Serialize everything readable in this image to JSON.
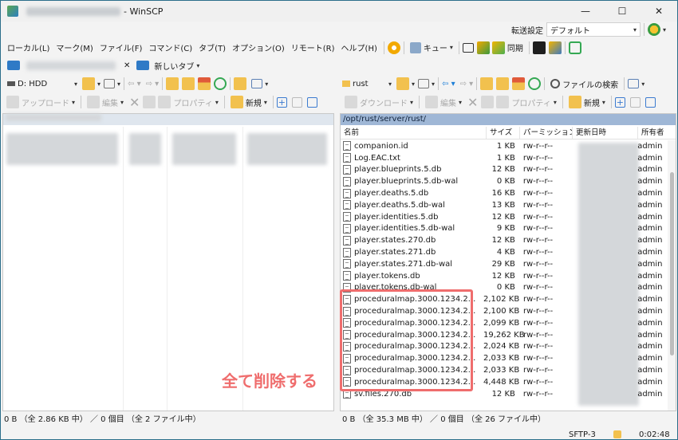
{
  "window": {
    "title_suffix": "- WinSCP",
    "min": "—",
    "max": "☐",
    "close": "✕"
  },
  "prefs": {
    "label": "転送設定",
    "preset": "デフォルト"
  },
  "menu": [
    "ローカル(L)",
    "マーク(M)",
    "ファイル(F)",
    "コマンド(C)",
    "タブ(T)",
    "オプション(O)",
    "リモート(R)",
    "ヘルプ(H)"
  ],
  "toolbar": {
    "queue": "キュー",
    "sync": "同期"
  },
  "tabs": {
    "close": "✕",
    "new_tab": "新しいタブ"
  },
  "left": {
    "drive": "D: HDD",
    "upload": "アップロード",
    "edit": "編集",
    "properties": "プロパティ",
    "new": "新規",
    "status": "0 B （全 2.86 KB 中） ／ 0 個目 （全 2 ファイル中）"
  },
  "right": {
    "dir": "rust",
    "find": "ファイルの検索",
    "download": "ダウンロード",
    "edit": "編集",
    "properties": "プロパティ",
    "new": "新規",
    "path": "/opt/rust/server/rust/",
    "cols": {
      "name": "名前",
      "size": "サイズ",
      "perm": "パーミッション",
      "date": "更新日時",
      "owner": "所有者"
    },
    "status": "0 B （全 35.3 MB 中） ／ 0 個目 （全 26 ファイル中）",
    "files": [
      {
        "name": "companion.id",
        "size": "1 KB",
        "perm": "rw-r--r--",
        "owner": "admin"
      },
      {
        "name": "Log.EAC.txt",
        "size": "1 KB",
        "perm": "rw-r--r--",
        "owner": "admin"
      },
      {
        "name": "player.blueprints.5.db",
        "size": "12 KB",
        "perm": "rw-r--r--",
        "owner": "admin"
      },
      {
        "name": "player.blueprints.5.db-wal",
        "size": "0 KB",
        "perm": "rw-r--r--",
        "owner": "admin"
      },
      {
        "name": "player.deaths.5.db",
        "size": "16 KB",
        "perm": "rw-r--r--",
        "owner": "admin"
      },
      {
        "name": "player.deaths.5.db-wal",
        "size": "13 KB",
        "perm": "rw-r--r--",
        "owner": "admin"
      },
      {
        "name": "player.identities.5.db",
        "size": "12 KB",
        "perm": "rw-r--r--",
        "owner": "admin"
      },
      {
        "name": "player.identities.5.db-wal",
        "size": "9 KB",
        "perm": "rw-r--r--",
        "owner": "admin"
      },
      {
        "name": "player.states.270.db",
        "size": "12 KB",
        "perm": "rw-r--r--",
        "owner": "admin"
      },
      {
        "name": "player.states.271.db",
        "size": "4 KB",
        "perm": "rw-r--r--",
        "owner": "admin"
      },
      {
        "name": "player.states.271.db-wal",
        "size": "29 KB",
        "perm": "rw-r--r--",
        "owner": "admin"
      },
      {
        "name": "player.tokens.db",
        "size": "12 KB",
        "perm": "rw-r--r--",
        "owner": "admin"
      },
      {
        "name": "player.tokens.db-wal",
        "size": "0 KB",
        "perm": "rw-r--r--",
        "owner": "admin"
      },
      {
        "name": "proceduralmap.3000.1234.2...",
        "size": "2,102 KB",
        "perm": "rw-r--r--",
        "owner": "admin"
      },
      {
        "name": "proceduralmap.3000.1234.2...",
        "size": "2,100 KB",
        "perm": "rw-r--r--",
        "owner": "admin"
      },
      {
        "name": "proceduralmap.3000.1234.2...",
        "size": "2,099 KB",
        "perm": "rw-r--r--",
        "owner": "admin"
      },
      {
        "name": "proceduralmap.3000.1234.2...",
        "size": "19,262 KB",
        "perm": "rw-r--r--",
        "owner": "admin"
      },
      {
        "name": "proceduralmap.3000.1234.2...",
        "size": "2,024 KB",
        "perm": "rw-r--r--",
        "owner": "admin"
      },
      {
        "name": "proceduralmap.3000.1234.2...",
        "size": "2,033 KB",
        "perm": "rw-r--r--",
        "owner": "admin"
      },
      {
        "name": "proceduralmap.3000.1234.2...",
        "size": "2,033 KB",
        "perm": "rw-r--r--",
        "owner": "admin"
      },
      {
        "name": "proceduralmap.3000.1234.2...",
        "size": "4,448 KB",
        "perm": "rw-r--r--",
        "owner": "admin"
      },
      {
        "name": "sv.files.270.db",
        "size": "12 KB",
        "perm": "rw-r--r--",
        "owner": "admin"
      }
    ]
  },
  "annotation": "全て削除する",
  "footer": {
    "protocol": "SFTP-3",
    "time": "0:02:48"
  },
  "icons": {
    "app": "winscp-icon",
    "lock": "lock-icon",
    "gear": "gear-icon",
    "refresh": "refresh-icon",
    "home": "home-icon",
    "filter": "filter-icon",
    "folder": "folder-icon"
  }
}
